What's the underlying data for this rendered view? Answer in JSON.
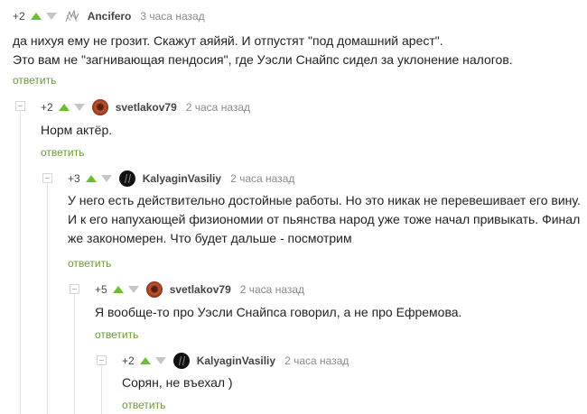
{
  "comments": [
    {
      "rating": "+2",
      "author": "Ancifero",
      "time": "3 часа назад",
      "lines": [
        "да нихуя ему не грозит. Скажут аяйяй. И отпустят \"под домашний арест\".",
        "Это вам не \"загнивающая пендосия\", где Уэсли Снайпс сидел за уклонение налогов."
      ],
      "reply": "ответить"
    },
    {
      "rating": "+2",
      "author": "svetlakov79",
      "time": "2 часа назад",
      "lines": [
        "Норм актёр."
      ],
      "reply": "ответить"
    },
    {
      "rating": "+3",
      "author": "KalyaginVasiliy",
      "time": "2 часа назад",
      "lines": [
        "У него есть действительно достойные работы. Но это никак не перевешивает его вину.",
        "И к его напухающей физиономии от пьянства народ уже тоже начал привыкать. Финал",
        "же закономерен. Что будет дальше - посмотрим"
      ],
      "reply": "ответить"
    },
    {
      "rating": "+5",
      "author": "svetlakov79",
      "time": "2 часа назад",
      "lines": [
        "Я вообще-то про Уэсли Снайпса говорил, а не про Ефремова."
      ],
      "reply": "ответить"
    },
    {
      "rating": "+2",
      "author": "KalyaginVasiliy",
      "time": "2 часа назад",
      "lines": [
        "Сорян, не въехал )"
      ],
      "reply": "ответить"
    }
  ],
  "colors": {
    "upvote": "#6bbf2f",
    "downvote": "#c6c6c6",
    "reply_link": "#6a9a3a",
    "rail": "#e3e3e3"
  },
  "icons": [
    "collapse-icon",
    "upvote-icon",
    "downvote-icon",
    "avatar"
  ]
}
